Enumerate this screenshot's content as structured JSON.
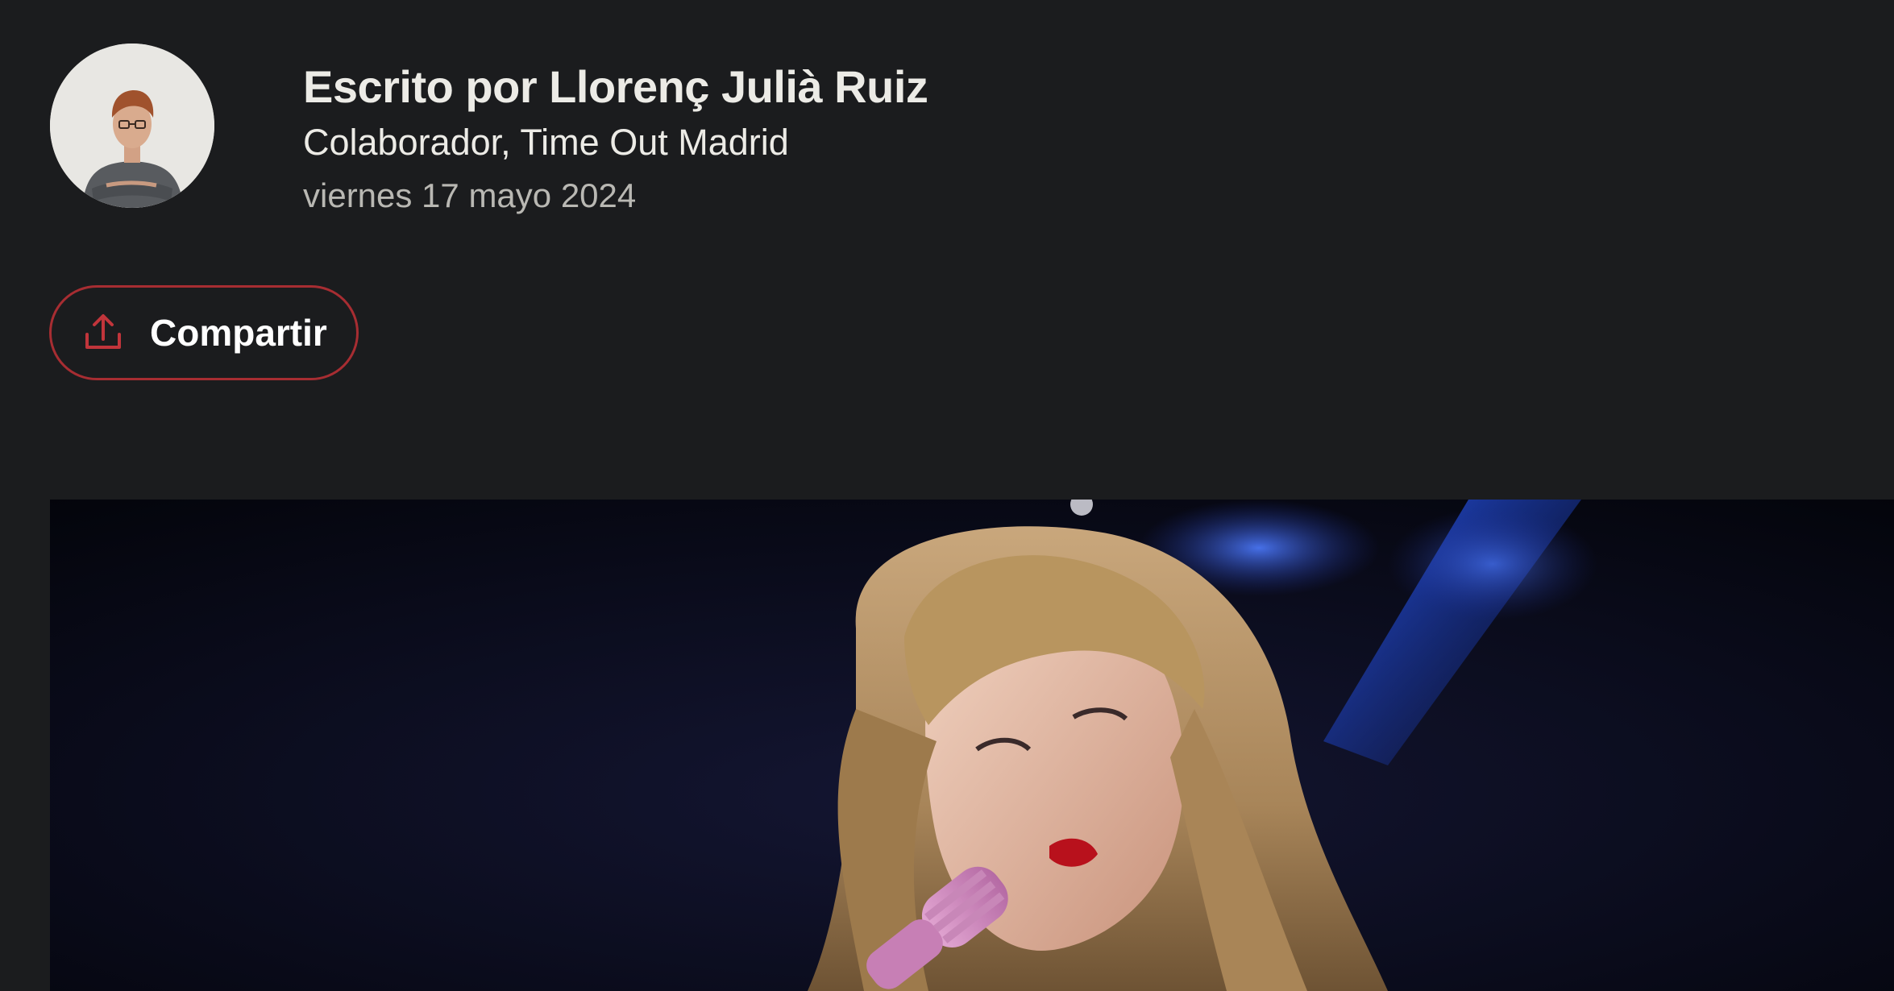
{
  "author": {
    "name": "Escrito por Llorenç Julià Ruiz",
    "role": "Colaborador, Time Out Madrid",
    "date": "viernes 17 mayo 2024"
  },
  "share": {
    "label": "Compartir",
    "icon": "share-upload-icon"
  },
  "colors": {
    "background": "#1b1c1e",
    "accent": "#a72d32",
    "text": "#ecebe6",
    "muted": "#b9b8b3"
  }
}
